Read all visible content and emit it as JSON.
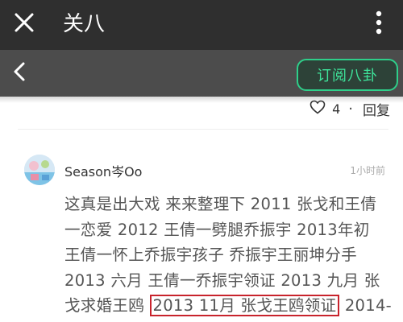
{
  "header": {
    "title": "关八",
    "close_icon": "close-icon",
    "more_icon": "more-vertical-icon"
  },
  "subheader": {
    "back_icon": "back-chevron-icon",
    "subscribe_label": "订阅八卦",
    "accent": "#2ecf8a"
  },
  "post_actions": {
    "like_icon": "heart-outline-icon",
    "like_count": "4",
    "separator": "·",
    "reply_label": "回复"
  },
  "comment": {
    "username": "Season岑Oo",
    "time": "1小时前",
    "lines": [
      "这真是出大戏 来来整理下 2011 张戈和王倩",
      "一恋爱 2012 王倩一劈腿乔振宇 2013年初",
      "王倩一怀上乔振宇孩子 乔振宇王丽坤分手",
      "2013 六月 王倩一乔振宇领证 2013 九月 张"
    ],
    "last_line_prefix": "戈求婚王鸥 ",
    "last_line_highlight": "2013 11月 张戈王鸥领证",
    "last_line_suffix": " 2014-",
    "highlight_color": "#c8232c"
  }
}
